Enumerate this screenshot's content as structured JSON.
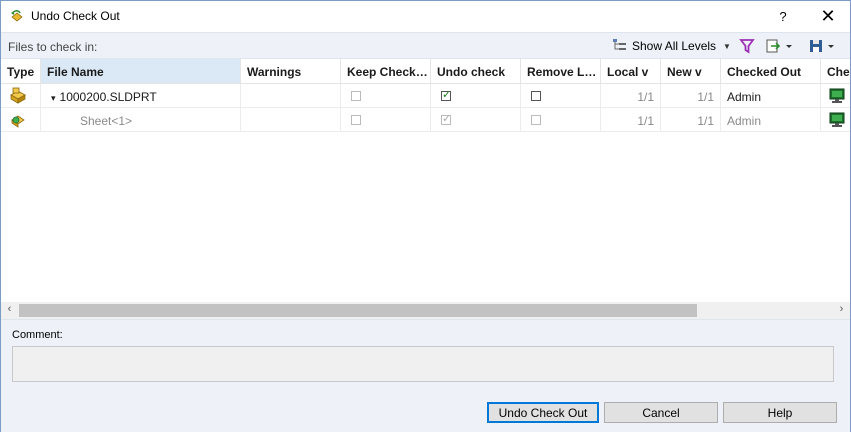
{
  "window": {
    "title": "Undo Check Out",
    "help_label": "?",
    "close_label": "✕"
  },
  "toolbar": {
    "files_label": "Files to check in:",
    "levels_label": "Show All Levels",
    "icons": [
      "tree-icon",
      "filter-icon",
      "export-icon",
      "save-icon"
    ],
    "filter_color": "#9b2fb5"
  },
  "columns": [
    "Type",
    "File Name",
    "Warnings",
    "Keep Check…",
    "Undo check",
    "Remove L…",
    "Local v",
    "New v",
    "Checked Out",
    "Chec"
  ],
  "rows": [
    {
      "type_icon": "part-icon",
      "expander": "▾",
      "file_name": "1000200.SLDPRT",
      "warnings": "",
      "keep_checked": false,
      "keep_enabled": false,
      "undo_check": true,
      "undo_enabled": true,
      "remove_local": false,
      "remove_enabled": true,
      "local_v": "1/1",
      "new_v": "1/1",
      "checked_out": "Admin",
      "checked_out_on_icon": "computer-icon"
    },
    {
      "type_icon": "sheet-icon",
      "expander": "",
      "file_name": "Sheet<1>",
      "warnings": "",
      "keep_checked": false,
      "keep_enabled": false,
      "undo_check": true,
      "undo_enabled": false,
      "remove_local": false,
      "remove_enabled": false,
      "local_v": "1/1",
      "new_v": "1/1",
      "checked_out": "Admin",
      "checked_out_on_icon": "computer-icon"
    }
  ],
  "comment": {
    "label": "Comment:",
    "value": ""
  },
  "buttons": {
    "undo": "Undo Check Out",
    "cancel": "Cancel",
    "help": "Help"
  },
  "scrollbar": {
    "left_arrow": "‹",
    "right_arrow": "›"
  }
}
